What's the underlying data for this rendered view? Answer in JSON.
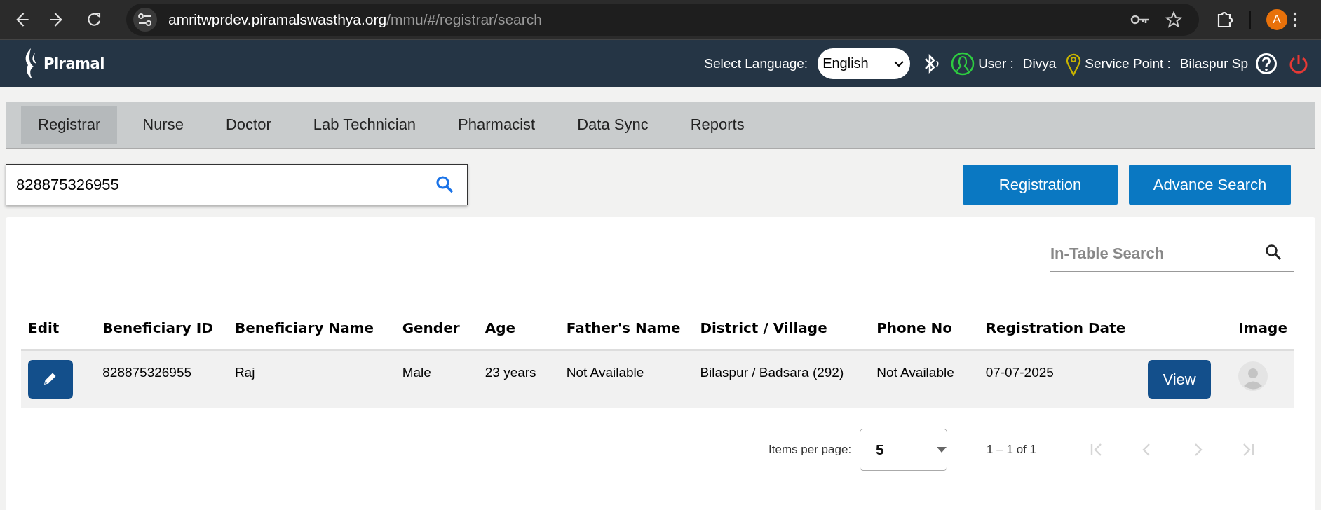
{
  "browser": {
    "url_host": "amritwprdev.piramalswasthya.org",
    "url_path": "/mmu/#/registrar/search",
    "profile_letter": "A"
  },
  "header": {
    "logo_text": "Piramal",
    "language_label": "Select Language:",
    "language": "English",
    "user_label": "User :",
    "user_name": "Divya",
    "service_label": "Service Point :",
    "service_point": "Bilaspur Sp"
  },
  "tabs": [
    {
      "label": "Registrar",
      "selected": true
    },
    {
      "label": "Nurse",
      "selected": false
    },
    {
      "label": "Doctor",
      "selected": false
    },
    {
      "label": "Lab Technician",
      "selected": false
    },
    {
      "label": "Pharmacist",
      "selected": false
    },
    {
      "label": "Data Sync",
      "selected": false
    },
    {
      "label": "Reports",
      "selected": false
    }
  ],
  "search": {
    "value": "828875326955"
  },
  "buttons": [
    "Registration",
    "Advance Search"
  ],
  "table_search": {
    "placeholder": "In-Table Search"
  },
  "table": {
    "columns": [
      {
        "kind": "edit",
        "label": "Edit"
      },
      {
        "kind": "text",
        "label": "Beneficiary ID"
      },
      {
        "kind": "text",
        "label": "Beneficiary Name"
      },
      {
        "kind": "text",
        "label": "Gender"
      },
      {
        "kind": "text",
        "label": "Age"
      },
      {
        "kind": "text",
        "label": "Father's Name"
      },
      {
        "kind": "text",
        "label": "District / Village"
      },
      {
        "kind": "text",
        "label": "Phone No"
      },
      {
        "kind": "text",
        "label": "Registration Date"
      },
      {
        "kind": "action"
      },
      {
        "kind": "image",
        "label": "Image"
      }
    ],
    "rows": [
      {
        "cells": [
          "",
          "828875326955",
          "Raj",
          "Male",
          "23 years",
          "Not Available",
          "Bilaspur / Badsara (292)",
          "Not Available",
          "07-07-2025",
          "View",
          ""
        ]
      }
    ]
  },
  "pagination": {
    "items_per_page_label": "Items per page:",
    "page_size": "5",
    "range": "1 – 1 of 1",
    "nav": [
      {
        "kind": "first",
        "disabled": true
      },
      {
        "kind": "previous",
        "disabled": true
      },
      {
        "kind": "next",
        "disabled": true
      },
      {
        "kind": "last",
        "disabled": true
      }
    ]
  }
}
